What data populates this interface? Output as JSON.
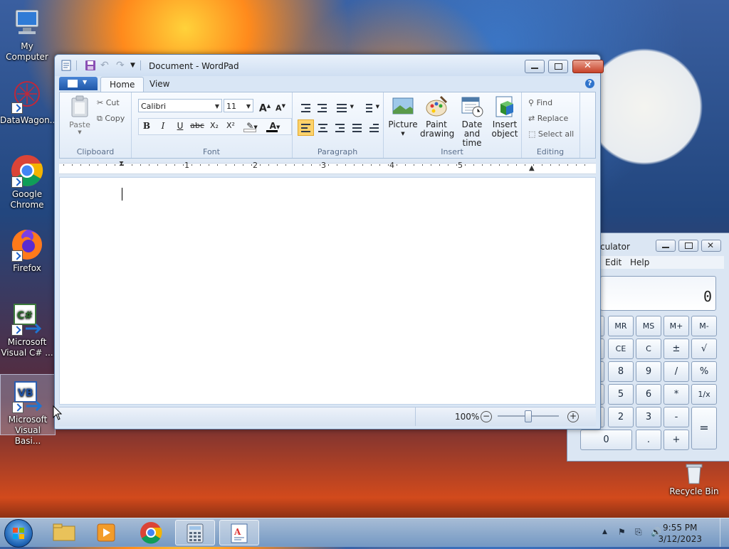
{
  "desktop": {
    "icons": [
      {
        "label": "My Computer"
      },
      {
        "label": "DataWagon..."
      },
      {
        "label": "Google Chrome"
      },
      {
        "label": "Firefox"
      },
      {
        "label": "Microsoft Visual C# ..."
      },
      {
        "label": "Microsoft Visual Basi..."
      }
    ],
    "recycle_bin": "Recycle Bin"
  },
  "wordpad": {
    "title": "Document - WordPad",
    "tabs": [
      "Home",
      "View"
    ],
    "clipboard": {
      "paste": "Paste",
      "cut": "Cut",
      "copy": "Copy",
      "group": "Clipboard"
    },
    "font": {
      "family": "Calibri",
      "size": "11",
      "group": "Font",
      "bold": "B",
      "italic": "I",
      "underline": "U",
      "strike": "abc",
      "subscript": "X₂",
      "superscript": "X²",
      "grow": "A",
      "shrink": "A"
    },
    "paragraph": {
      "group": "Paragraph"
    },
    "insert": {
      "picture": "Picture",
      "paint_1": "Paint",
      "paint_2": "drawing",
      "datetime_1": "Date and",
      "datetime_2": "time",
      "object_1": "Insert",
      "object_2": "object",
      "group": "Insert"
    },
    "editing": {
      "find": "Find",
      "replace": "Replace",
      "select_all": "Select all",
      "group": "Editing"
    },
    "ruler_numbers": [
      "1",
      "2",
      "3",
      "4",
      "5"
    ],
    "zoom": "100%"
  },
  "calculator": {
    "title": "culator",
    "menu": [
      "Edit",
      "Help"
    ],
    "display": "0",
    "rows": [
      [
        "MR",
        "MS",
        "M+",
        "M-"
      ],
      [
        "CE",
        "C",
        "±",
        "√"
      ],
      [
        "8",
        "9",
        "/",
        "%"
      ],
      [
        "5",
        "6",
        "*",
        "1/x"
      ],
      [
        "2",
        "3",
        "-"
      ]
    ],
    "zero": "0",
    "dot": ".",
    "plus": "+",
    "equals": "="
  },
  "taskbar": {
    "time": "9:55 PM",
    "date": "3/12/2023"
  },
  "colors": {
    "accent": "#1f57a8",
    "highlight": "#fcd26b"
  }
}
